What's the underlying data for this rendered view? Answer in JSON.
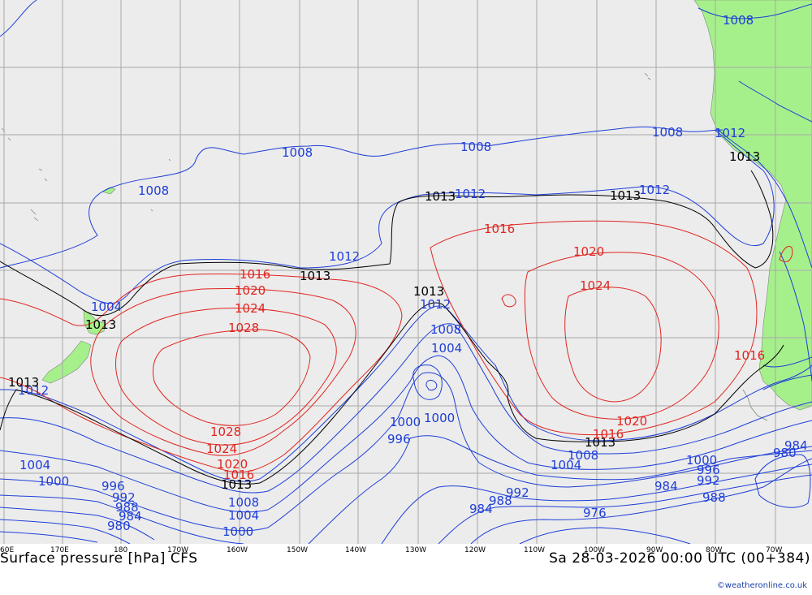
{
  "title": {
    "left": "Surface pressure [hPa] CFS",
    "right": "Sa 28-03-2026 00:00 UTC (00+384)"
  },
  "credit": "©weatheronline.co.uk",
  "colors": {
    "ocean": "#ececec",
    "land": "#a6f08c",
    "grid": "#a9a9a9",
    "low_isobar": "#1e3ed8",
    "high_isobar": "#e0251f",
    "reference_isobar": "#000000"
  },
  "longitude_labels": [
    "60E",
    "170E",
    "180",
    "170W",
    "160W",
    "150W",
    "140W",
    "130W",
    "120W",
    "110W",
    "100W",
    "90W",
    "80W",
    "70W"
  ],
  "isobar_labels": {
    "l1008a": "1008",
    "l1008b": "1008",
    "l1008c": "1008",
    "l1008d": "1008",
    "l1008e": "1008",
    "l1012a": "1012",
    "l1012b": "1012",
    "l1012c": "1012",
    "l1012d": "1012",
    "l1012e": "1012",
    "l1012f": "1012",
    "l1013a": "1013",
    "l1013b": "1013",
    "l1013c": "1013",
    "l1013d": "1013",
    "l1013e": "1013",
    "l1013f": "1013",
    "l1013g": "1013",
    "l1013h": "1013",
    "l1016a": "1016",
    "l1016b": "1016",
    "l1016c": "1016",
    "l1016d": "1016",
    "l1016e": "1016",
    "l1020a": "1020",
    "l1020b": "1020",
    "l1020c": "1020",
    "l1020d": "1020",
    "l1024a": "1024",
    "l1024b": "1024",
    "l1024c": "1024",
    "l1028a": "1028",
    "l1028b": "1028",
    "l1008f": "1008",
    "l1008g": "1008",
    "l1008h": "1008",
    "l1004a": "1004",
    "l1004b": "1004",
    "l1004c": "1004",
    "l1004d": "1004",
    "l1004e": "1004",
    "l1000a": "1000",
    "l1000b": "1000",
    "l1000c": "1000",
    "l1000d": "1000",
    "l1000e": "1000",
    "l996a": "996",
    "l996b": "996",
    "l996c": "996",
    "l992a": "992",
    "l992b": "992",
    "l992c": "992",
    "l988a": "988",
    "l988b": "988",
    "l988c": "988",
    "l984a": "984",
    "l984b": "984",
    "l984c": "984",
    "l984d": "984",
    "l980a": "980",
    "l980b": "980",
    "l976a": "976"
  }
}
